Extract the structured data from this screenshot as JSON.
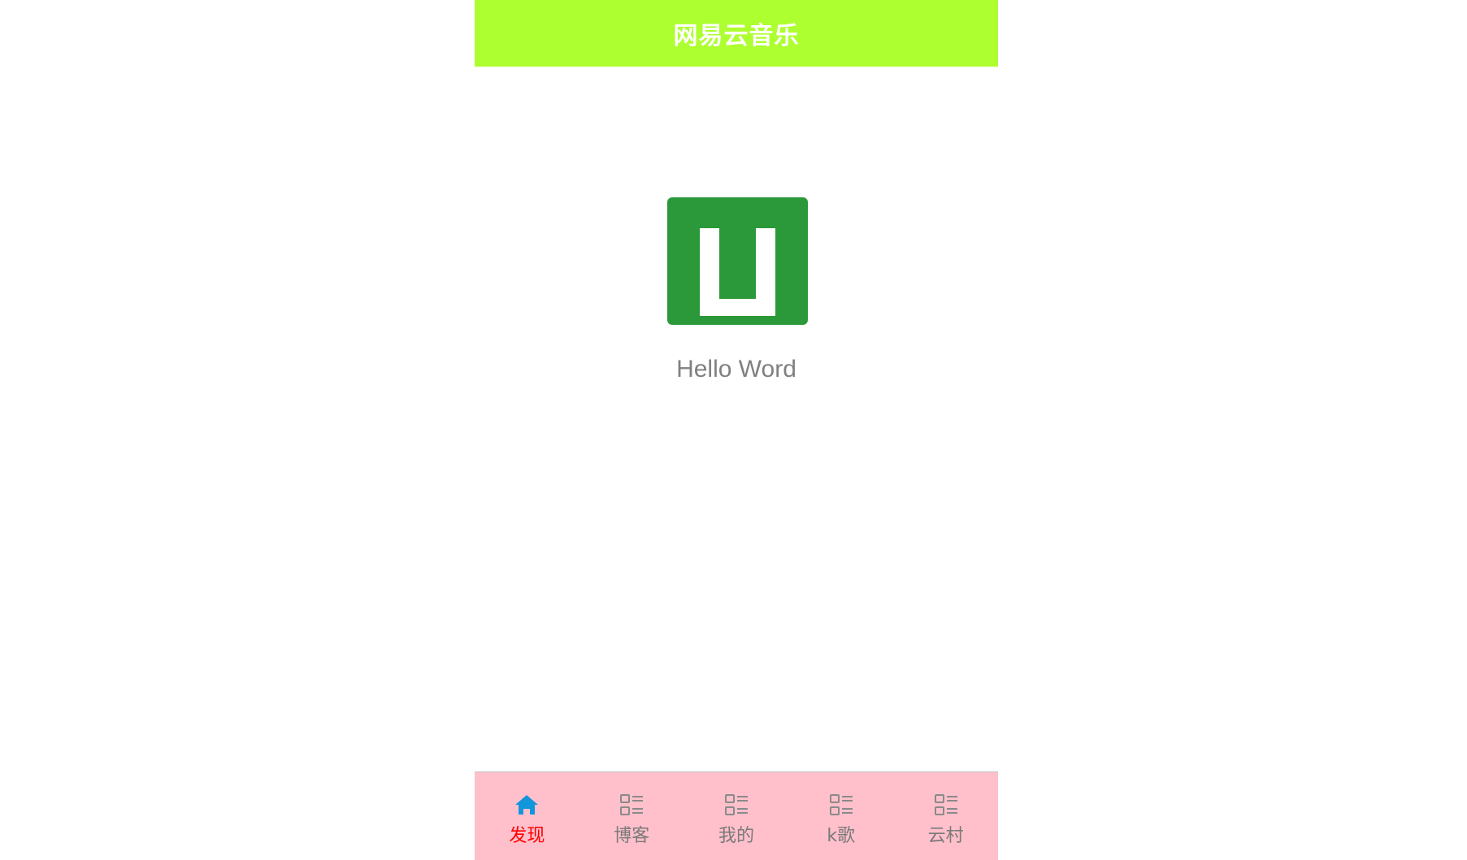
{
  "navbar": {
    "title": "网易云音乐"
  },
  "main": {
    "greeting": "Hello Word"
  },
  "tabbar": {
    "items": [
      {
        "label": "发现",
        "icon": "home-icon",
        "active": true
      },
      {
        "label": "博客",
        "icon": "list-icon",
        "active": false
      },
      {
        "label": "我的",
        "icon": "list-icon",
        "active": false
      },
      {
        "label": "k歌",
        "icon": "list-icon",
        "active": false
      },
      {
        "label": "云村",
        "icon": "list-icon",
        "active": false
      }
    ]
  },
  "colors": {
    "navbar_bg": "#adff2f",
    "tabbar_bg": "#ffc0cb",
    "active_label": "#ff0000",
    "active_icon": "#1296db",
    "inactive": "#7a7a7a",
    "logo_bg": "#2b9939"
  }
}
